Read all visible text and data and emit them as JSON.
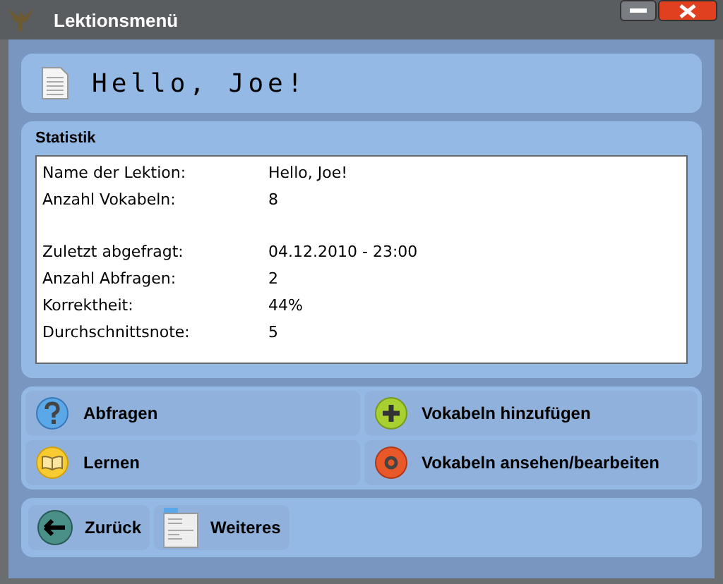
{
  "window": {
    "title": "Lektionsmenü"
  },
  "header": {
    "title": "Hello, Joe!"
  },
  "statistics": {
    "title": "Statistik",
    "groups": [
      [
        {
          "label": "Name der Lektion:",
          "value": "Hello, Joe!"
        },
        {
          "label": "Anzahl Vokabeln:",
          "value": "8"
        }
      ],
      [
        {
          "label": "Zuletzt abgefragt:",
          "value": "04.12.2010 - 23:00"
        },
        {
          "label": "Anzahl Abfragen:",
          "value": "2"
        },
        {
          "label": "Korrektheit:",
          "value": "44%"
        },
        {
          "label": "Durchschnittsnote:",
          "value": "5"
        }
      ]
    ]
  },
  "actions": [
    {
      "label": "Abfragen",
      "kind": "question"
    },
    {
      "label": "Vokabeln hinzufügen",
      "kind": "add"
    },
    {
      "label": "Lernen",
      "kind": "book"
    },
    {
      "label": "Vokabeln ansehen/bearbeiten",
      "kind": "view"
    }
  ],
  "footer": [
    {
      "label": "Zurück",
      "kind": "back"
    },
    {
      "label": "Weiteres",
      "kind": "menu"
    }
  ]
}
